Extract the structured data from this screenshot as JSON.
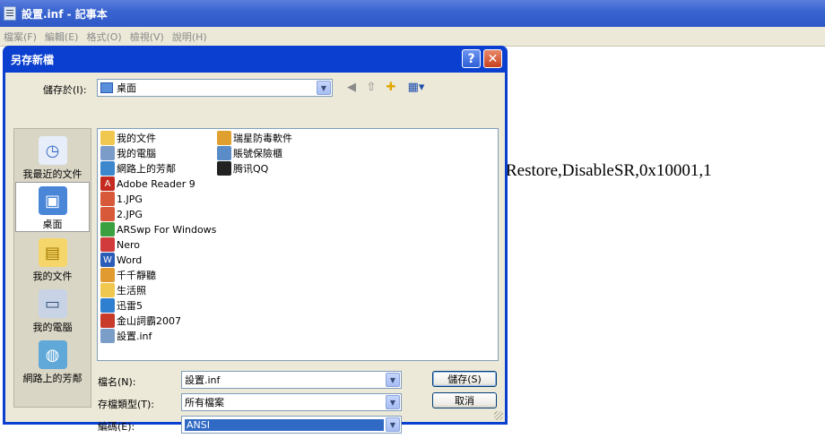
{
  "notepad": {
    "title": "設置.inf - 記事本",
    "menu": [
      "檔案(F)",
      "編輯(E)",
      "格式(O)",
      "檢視(V)",
      "說明(H)"
    ],
    "content_text": "Restore,DisableSR,0x10001,1"
  },
  "dialog": {
    "title": "另存新檔",
    "help_label": "?",
    "close_label": "✕",
    "save_in_label": "儲存於(I):",
    "save_in_value": "桌面",
    "places": [
      {
        "label": "我最近的文件",
        "icon": "recent-icon"
      },
      {
        "label": "桌面",
        "icon": "desktop-icon"
      },
      {
        "label": "我的文件",
        "icon": "my-documents-icon"
      },
      {
        "label": "我的電腦",
        "icon": "my-computer-icon"
      },
      {
        "label": "網路上的芳鄰",
        "icon": "network-icon"
      }
    ],
    "files_col1": [
      "我的文件",
      "我的電腦",
      "網路上的芳鄰",
      "Adobe Reader 9",
      "1.JPG",
      "2.JPG",
      "ARSwp For Windows",
      "Nero",
      "Word",
      "千千靜聽",
      "生活照",
      "迅雷5",
      "金山詞霸2007",
      "設置.inf"
    ],
    "files_col2": [
      "瑞星防毒軟件",
      "賬號保險櫃",
      "腾讯QQ"
    ],
    "filename_label": "檔名(N):",
    "filename_value": "設置.inf",
    "filetype_label": "存檔類型(T):",
    "filetype_value": "所有檔案",
    "encoding_label": "編碼(E):",
    "encoding_value": "ANSI",
    "save_button": "儲存(S)",
    "cancel_button": "取消"
  },
  "colors": {
    "titlebar": "#2f58c8",
    "dialog_frame": "#0a3fcf",
    "dialog_body": "#ece9d8",
    "selection": "#316ac5"
  }
}
